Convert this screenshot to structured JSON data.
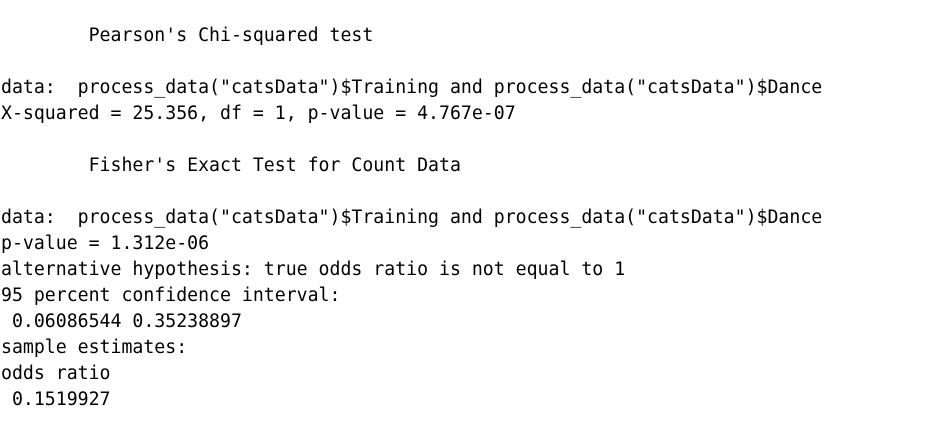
{
  "console": {
    "lines": [
      "        Pearson's Chi-squared test",
      "",
      "data:  process_data(\"catsData\")$Training and process_data(\"catsData\")$Dance",
      "X-squared = 25.356, df = 1, p-value = 4.767e-07",
      "",
      "        Fisher's Exact Test for Count Data",
      "",
      "data:  process_data(\"catsData\")$Training and process_data(\"catsData\")$Dance",
      "p-value = 1.312e-06",
      "alternative hypothesis: true odds ratio is not equal to 1",
      "95 percent confidence interval:",
      " 0.06086544 0.35238897",
      "sample estimates:",
      "odds ratio",
      " 0.1519927"
    ],
    "text_color": "#000000",
    "background_color": "#ffffff"
  }
}
